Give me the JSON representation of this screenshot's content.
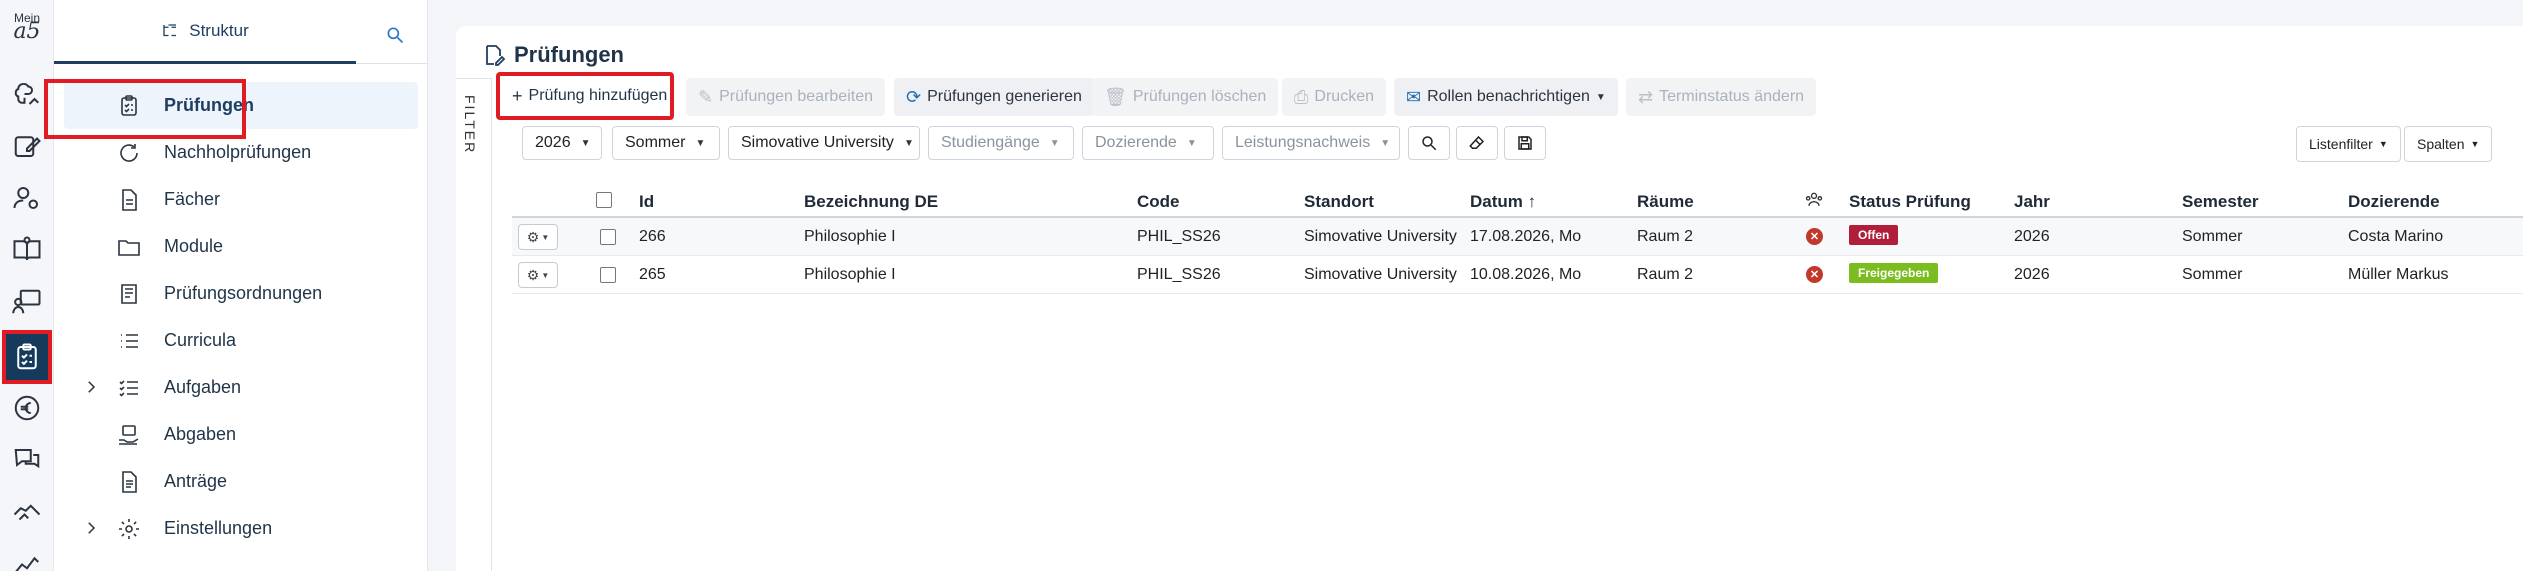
{
  "logo": {
    "top_text": "Mein",
    "glyph": "a5"
  },
  "structure": {
    "tab_label": "Struktur"
  },
  "nav": {
    "items": [
      {
        "label": "Prüfungen",
        "icon": "clipboard-check-icon",
        "active": true,
        "expandable": false
      },
      {
        "label": "Nachholprüfungen",
        "icon": "refresh-icon",
        "active": false,
        "expandable": false
      },
      {
        "label": "Fächer",
        "icon": "document-icon",
        "active": false,
        "expandable": false
      },
      {
        "label": "Module",
        "icon": "folder-icon",
        "active": false,
        "expandable": false
      },
      {
        "label": "Prüfungsordnungen",
        "icon": "book-list-icon",
        "active": false,
        "expandable": false
      },
      {
        "label": "Curricula",
        "icon": "list-icon",
        "active": false,
        "expandable": false
      },
      {
        "label": "Aufgaben",
        "icon": "checklist-icon",
        "active": false,
        "expandable": true
      },
      {
        "label": "Abgaben",
        "icon": "inbox-hand-icon",
        "active": false,
        "expandable": false
      },
      {
        "label": "Anträge",
        "icon": "document-lines-icon",
        "active": false,
        "expandable": false
      },
      {
        "label": "Einstellungen",
        "icon": "gear-icon",
        "active": false,
        "expandable": true
      }
    ]
  },
  "page": {
    "title": "Prüfungen",
    "filter_label": "FILTER"
  },
  "toolbar": {
    "add": "Prüfung hinzufügen",
    "edit": "Prüfungen bearbeiten",
    "generate": "Prüfungen generieren",
    "delete": "Prüfungen löschen",
    "print": "Drucken",
    "notify": "Rollen benachrichtigen",
    "status": "Terminstatus ändern"
  },
  "filters": {
    "year": "2026",
    "semester": "Sommer",
    "university": "Simovative University",
    "programs": "Studiengänge",
    "lecturers": "Dozierende",
    "assessment": "Leistungsnachweis"
  },
  "list_controls": {
    "list_filter": "Listenfilter",
    "columns": "Spalten"
  },
  "table": {
    "headers": {
      "id": "Id",
      "name": "Bezeichnung DE",
      "code": "Code",
      "location": "Standort",
      "date": "Datum",
      "rooms": "Räume",
      "status": "Status Prüfung",
      "year": "Jahr",
      "semester": "Semester",
      "lecturer": "Dozierende"
    },
    "rows": [
      {
        "id": "266",
        "name": "Philosophie I",
        "code": "PHIL_SS26",
        "location": "Simovative University",
        "date": "17.08.2026, Mo",
        "rooms": "Raum 2",
        "status": "Offen",
        "status_color": "#b01e3a",
        "year": "2026",
        "semester": "Sommer",
        "lecturer": "Costa Marino"
      },
      {
        "id": "265",
        "name": "Philosophie I",
        "code": "PHIL_SS26",
        "location": "Simovative University",
        "date": "10.08.2026, Mo",
        "rooms": "Raum 2",
        "status": "Freigegeben",
        "status_color": "#7bbd1f",
        "year": "2026",
        "semester": "Sommer",
        "lecturer": "Müller Markus"
      }
    ]
  },
  "colors": {
    "highlight": "#e01b24",
    "brand": "#1f3f61",
    "active_rail": "#163a5c"
  }
}
